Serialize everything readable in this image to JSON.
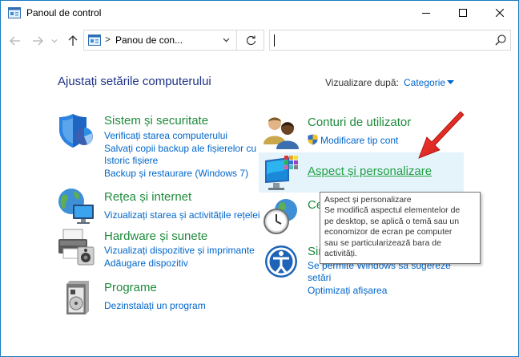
{
  "window": {
    "title": "Panoul de control"
  },
  "address_bar": {
    "separator": ">",
    "path": "Panou de con..."
  },
  "search": {
    "value": ""
  },
  "header": {
    "title": "Ajustați setările computerului",
    "view_by_label": "Vizualizare după:",
    "view_by_value": "Categorie"
  },
  "categories": {
    "system": {
      "title": "Sistem și securitate",
      "links": [
        "Verificați starea computerului",
        "Salvați copii backup ale fișierelor cu",
        "Istoric fișiere",
        "Backup și restaurare (Windows 7)"
      ]
    },
    "network": {
      "title": "Rețea și internet",
      "links": [
        "Vizualizați starea și activitățile rețelei"
      ]
    },
    "hardware": {
      "title": "Hardware și sunete",
      "links": [
        "Vizualizați dispozitive și imprimante",
        "Adăugare dispozitiv"
      ]
    },
    "programs": {
      "title": "Programe",
      "links": [
        "Dezinstalați un program"
      ]
    },
    "accounts": {
      "title": "Conturi de utilizator",
      "links": [
        "Modificare tip cont"
      ]
    },
    "appearance": {
      "title": "Aspect și personalizare"
    },
    "clock": {
      "title_partial": "Cea"
    },
    "ease": {
      "title_partial": "Sim",
      "links_partial": [
        "Se permite Windows să sugereze",
        "setări",
        "Optimizați afișarea"
      ]
    }
  },
  "tooltip": {
    "lines": [
      "Aspect și personalizare",
      "Se modifică aspectul elementelor de",
      "pe desktop, se aplică o temă sau un",
      "economizor de ecran pe computer",
      "sau se particularizează bara de",
      "activități."
    ]
  },
  "colors": {
    "accent": "#1a7ac2",
    "link": "#0066cc",
    "category_title": "#1f8a3c",
    "page_title": "#1e3287",
    "arrow": "#e02020"
  }
}
